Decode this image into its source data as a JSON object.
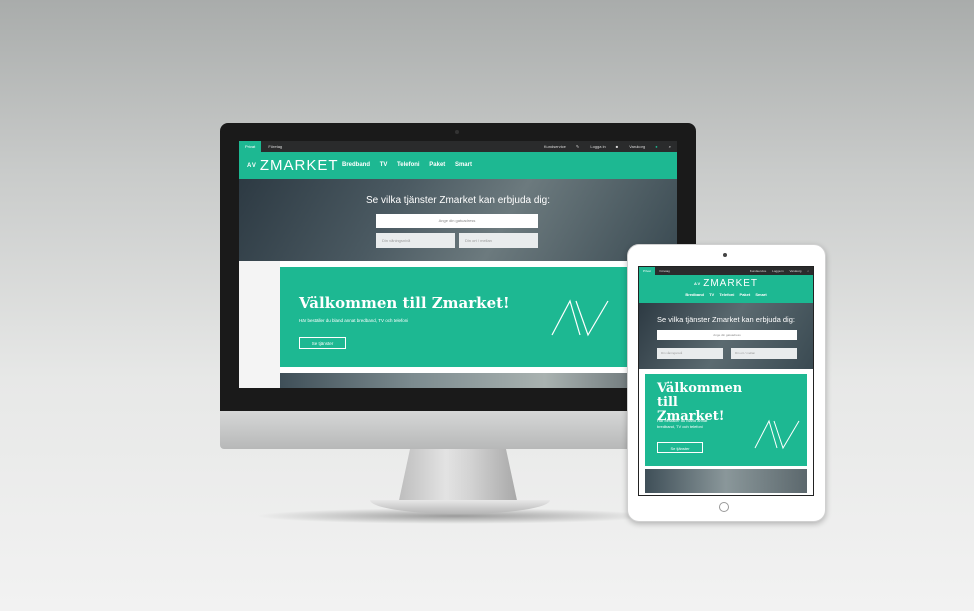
{
  "site": {
    "topbar": {
      "segments": [
        "Privat",
        "Företag"
      ],
      "right": [
        "Kundservice",
        "Logga in",
        "Varukorg"
      ],
      "search_icon": "search-icon"
    },
    "logo": {
      "mark": "AV",
      "word": "ZMARKET"
    },
    "nav": [
      "Bredband",
      "TV",
      "Telefoni",
      "Paket",
      "Smart"
    ],
    "hero": {
      "title": "Se vilka tjänster Zmarket kan erbjuda dig:",
      "address_placeholder": "Ange din gatuadress",
      "field1_placeholder": "Din våningsnivå",
      "field2_placeholder": "Din ort / mellan"
    },
    "welcome": {
      "title": "Välkommen till Zmarket!",
      "subtitle": "Här beställer du bland annat bredband, TV och telefoni",
      "button": "Se tjänster"
    },
    "tablet_welcome_title": [
      "Välkommen",
      "till Zmarket!"
    ],
    "tablet_subtitle": "Här beställer du bland annat bredband, TV och telefoni"
  },
  "colors": {
    "accent": "#1db892",
    "topbar": "#2a2b2c"
  }
}
